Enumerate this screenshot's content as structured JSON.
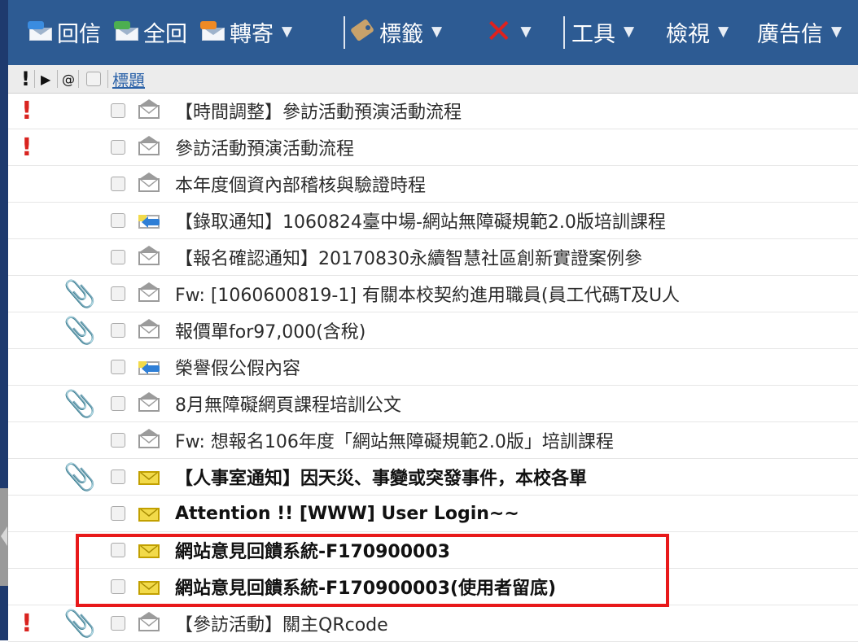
{
  "toolbar": {
    "reply_label": "回信",
    "reply_all_label": "全回",
    "forward_label": "轉寄",
    "tags_label": "標籤",
    "tools_label": "工具",
    "view_label": "檢視",
    "spam_label": "廣告信",
    "dropdown_glyph": "▼"
  },
  "columns": {
    "priority_glyph": "!",
    "flag_glyph": "▶",
    "attach_glyph": "@",
    "subject_header": "標題"
  },
  "messages": [
    {
      "important": "!",
      "attachment": "",
      "icon": "read",
      "subject": "【時間調整】參訪活動預演活動流程",
      "bold": false
    },
    {
      "important": "!",
      "attachment": "",
      "icon": "read",
      "subject": "參訪活動預演活動流程",
      "bold": false
    },
    {
      "important": "",
      "attachment": "",
      "icon": "read",
      "subject": "本年度個資內部稽核與驗證時程",
      "bold": false
    },
    {
      "important": "",
      "attachment": "",
      "icon": "replied",
      "subject": "【錄取通知】1060824臺中場-網站無障礙規範2.0版培訓課程",
      "bold": false
    },
    {
      "important": "",
      "attachment": "",
      "icon": "read",
      "subject": "【報名確認通知】20170830永續智慧社區創新實證案例參",
      "bold": false
    },
    {
      "important": "",
      "attachment": "📎",
      "icon": "read",
      "subject": "Fw: [1060600819-1] 有關本校契約進用職員(員工代碼T及U人",
      "bold": false
    },
    {
      "important": "",
      "attachment": "📎",
      "icon": "read",
      "subject": "報價單for97,000(含稅)",
      "bold": false
    },
    {
      "important": "",
      "attachment": "",
      "icon": "replied",
      "subject": "榮譽假公假內容",
      "bold": false
    },
    {
      "important": "",
      "attachment": "📎",
      "icon": "read",
      "subject": "8月無障礙網頁課程培訓公文",
      "bold": false
    },
    {
      "important": "",
      "attachment": "",
      "icon": "read",
      "subject": "Fw: 想報名106年度「網站無障礙規範2.0版」培訓課程",
      "bold": false
    },
    {
      "important": "",
      "attachment": "📎",
      "icon": "unread",
      "subject": "【人事室通知】因天災、事變或突發事件，本校各單",
      "bold": true
    },
    {
      "important": "",
      "attachment": "",
      "icon": "unread",
      "subject": "Attention !! [WWW] User Login~~",
      "bold": true
    },
    {
      "important": "",
      "attachment": "",
      "icon": "unread",
      "subject": "網站意見回饋系統-F170900003",
      "bold": true
    },
    {
      "important": "",
      "attachment": "",
      "icon": "unread",
      "subject": "網站意見回饋系統-F170900003(使用者留底)",
      "bold": true
    },
    {
      "important": "!",
      "attachment": "📎",
      "icon": "read",
      "subject": "【參訪活動】關主QRcode",
      "bold": false
    }
  ],
  "colors": {
    "toolbar_bg": "#2d5b93",
    "highlight": "#e8191a",
    "unread_icon": "#f2da4a",
    "important": "#d9231f"
  }
}
